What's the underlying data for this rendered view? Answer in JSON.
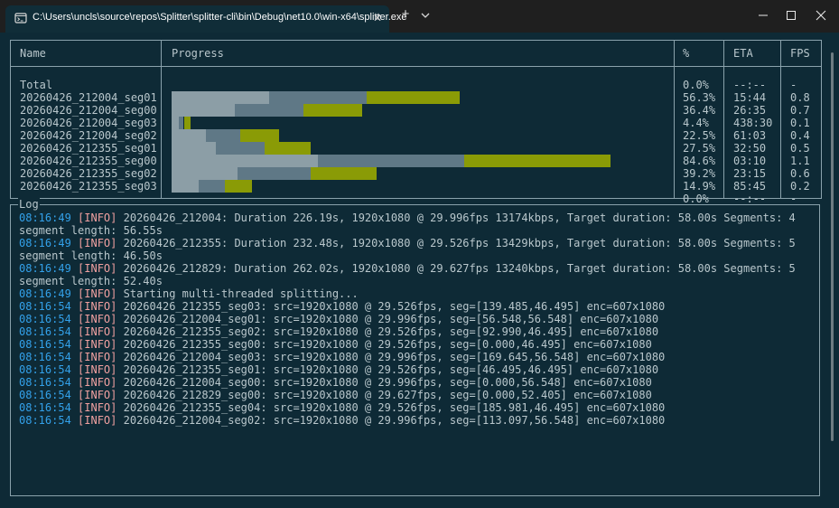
{
  "window": {
    "tab_title": "C:\\Users\\uncls\\source\\repos\\Splitter\\splitter-cli\\bin\\Debug\\net10.0\\win-x64\\splitter.exe",
    "close_tab": "✕",
    "new_tab": "+"
  },
  "table": {
    "headers": {
      "name": "Name",
      "progress": "Progress",
      "percent": "%",
      "eta": "ETA",
      "fps": "FPS"
    },
    "rows": [
      {
        "name": "Total",
        "percent": "0.0%",
        "eta": "--:--",
        "fps": "-",
        "done": 0,
        "mid": 0,
        "cur": 0
      },
      {
        "name": "20260426_212004_seg01",
        "percent": "56.3%",
        "eta": "15:44",
        "fps": "0.8",
        "done": 0.2,
        "mid": 0.2,
        "cur": 0.19
      },
      {
        "name": "20260426_212004_seg00",
        "percent": "36.4%",
        "eta": "26:35",
        "fps": "0.7",
        "done": 0.13,
        "mid": 0.14,
        "cur": 0.12
      },
      {
        "name": "20260426_212004_seg03",
        "percent": "4.4%",
        "eta": "438:30",
        "fps": "0.1",
        "done": 0.015,
        "mid": 0.01,
        "cur": 0.014
      },
      {
        "name": "20260426_212004_seg02",
        "percent": "22.5%",
        "eta": "61:03",
        "fps": "0.4",
        "done": 0.07,
        "mid": 0.07,
        "cur": 0.08
      },
      {
        "name": "20260426_212355_seg01",
        "percent": "27.5%",
        "eta": "32:50",
        "fps": "0.5",
        "done": 0.09,
        "mid": 0.1,
        "cur": 0.095
      },
      {
        "name": "20260426_212355_seg00",
        "percent": "84.6%",
        "eta": "03:10",
        "fps": "1.1",
        "done": 0.3,
        "mid": 0.3,
        "cur": 0.3
      },
      {
        "name": "20260426_212355_seg02",
        "percent": "39.2%",
        "eta": "23:15",
        "fps": "0.6",
        "done": 0.135,
        "mid": 0.15,
        "cur": 0.135
      },
      {
        "name": "20260426_212355_seg03",
        "percent": "14.9%",
        "eta": "85:45",
        "fps": "0.2",
        "done": 0.055,
        "mid": 0.055,
        "cur": 0.055
      },
      {
        "name": "",
        "percent": "0.0%",
        "eta": "--:--",
        "fps": "-",
        "done": 0,
        "mid": 0,
        "cur": 0
      }
    ]
  },
  "log": {
    "label": "Log",
    "lines": [
      {
        "ts": "08:16:49",
        "lvl": "[INFO]",
        "msg": "20260426_212004: Duration 226.19s, 1920x1080 @ 29.996fps 13174kbps, Target duration: 58.00s Segments: 4"
      },
      {
        "ts": "",
        "lvl": "",
        "msg": "segment length: 56.55s"
      },
      {
        "ts": "08:16:49",
        "lvl": "[INFO]",
        "msg": "20260426_212355: Duration 232.48s, 1920x1080 @ 29.526fps 13429kbps, Target duration: 58.00s Segments: 5"
      },
      {
        "ts": "",
        "lvl": "",
        "msg": "segment length: 46.50s"
      },
      {
        "ts": "08:16:49",
        "lvl": "[INFO]",
        "msg": "20260426_212829: Duration 262.02s, 1920x1080 @ 29.627fps 13240kbps, Target duration: 58.00s Segments: 5"
      },
      {
        "ts": "",
        "lvl": "",
        "msg": "segment length: 52.40s"
      },
      {
        "ts": "08:16:49",
        "lvl": "[INFO]",
        "msg": "Starting multi-threaded splitting..."
      },
      {
        "ts": "08:16:54",
        "lvl": "[INFO]",
        "msg": "20260426_212355_seg03: src=1920x1080 @ 29.526fps, seg=[139.485,46.495] enc=607x1080"
      },
      {
        "ts": "08:16:54",
        "lvl": "[INFO]",
        "msg": "20260426_212004_seg01: src=1920x1080 @ 29.996fps, seg=[56.548,56.548] enc=607x1080"
      },
      {
        "ts": "08:16:54",
        "lvl": "[INFO]",
        "msg": "20260426_212355_seg02: src=1920x1080 @ 29.526fps, seg=[92.990,46.495] enc=607x1080"
      },
      {
        "ts": "08:16:54",
        "lvl": "[INFO]",
        "msg": "20260426_212355_seg00: src=1920x1080 @ 29.526fps, seg=[0.000,46.495] enc=607x1080"
      },
      {
        "ts": "08:16:54",
        "lvl": "[INFO]",
        "msg": "20260426_212004_seg03: src=1920x1080 @ 29.996fps, seg=[169.645,56.548] enc=607x1080"
      },
      {
        "ts": "08:16:54",
        "lvl": "[INFO]",
        "msg": "20260426_212355_seg01: src=1920x1080 @ 29.526fps, seg=[46.495,46.495] enc=607x1080"
      },
      {
        "ts": "08:16:54",
        "lvl": "[INFO]",
        "msg": "20260426_212004_seg00: src=1920x1080 @ 29.996fps, seg=[0.000,56.548] enc=607x1080"
      },
      {
        "ts": "08:16:54",
        "lvl": "[INFO]",
        "msg": "20260426_212829_seg00: src=1920x1080 @ 29.627fps, seg=[0.000,52.405] enc=607x1080"
      },
      {
        "ts": "08:16:54",
        "lvl": "[INFO]",
        "msg": "20260426_212355_seg04: src=1920x1080 @ 29.526fps, seg=[185.981,46.495] enc=607x1080"
      },
      {
        "ts": "08:16:54",
        "lvl": "[INFO]",
        "msg": "20260426_212004_seg02: src=1920x1080 @ 29.996fps, seg=[113.097,56.548] enc=607x1080"
      }
    ]
  },
  "icons": {
    "tab": "terminal-icon",
    "dropdown": "chevron-down-icon",
    "minimize": "minimize-icon",
    "maximize": "maximize-icon",
    "close": "close-icon"
  },
  "colors": {
    "background": "#0e2a36",
    "timestamp": "#33a1ea",
    "info": "#f0a0a0",
    "bar_done": "#8c9ea6",
    "bar_mid": "#5f7886",
    "bar_current": "#8a9b06"
  }
}
